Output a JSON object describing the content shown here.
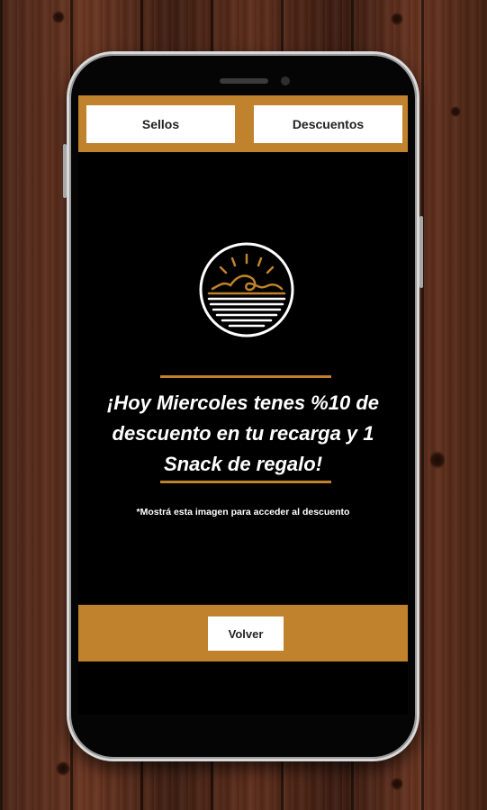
{
  "tabs": {
    "stamps_label": "Sellos",
    "discounts_label": "Descuentos"
  },
  "promo": {
    "headline": "¡Hoy Miercoles tenes %10 de descuento en tu recarga y 1 Snack de regalo!",
    "note": "*Mostrá esta imagen para acceder al descuento"
  },
  "actions": {
    "back_label": "Volver"
  },
  "colors": {
    "accent": "#c0822c",
    "screen_bg": "#000000",
    "button_bg": "#ffffff"
  },
  "icons": {
    "logo": "sun-wave-logo-icon"
  }
}
